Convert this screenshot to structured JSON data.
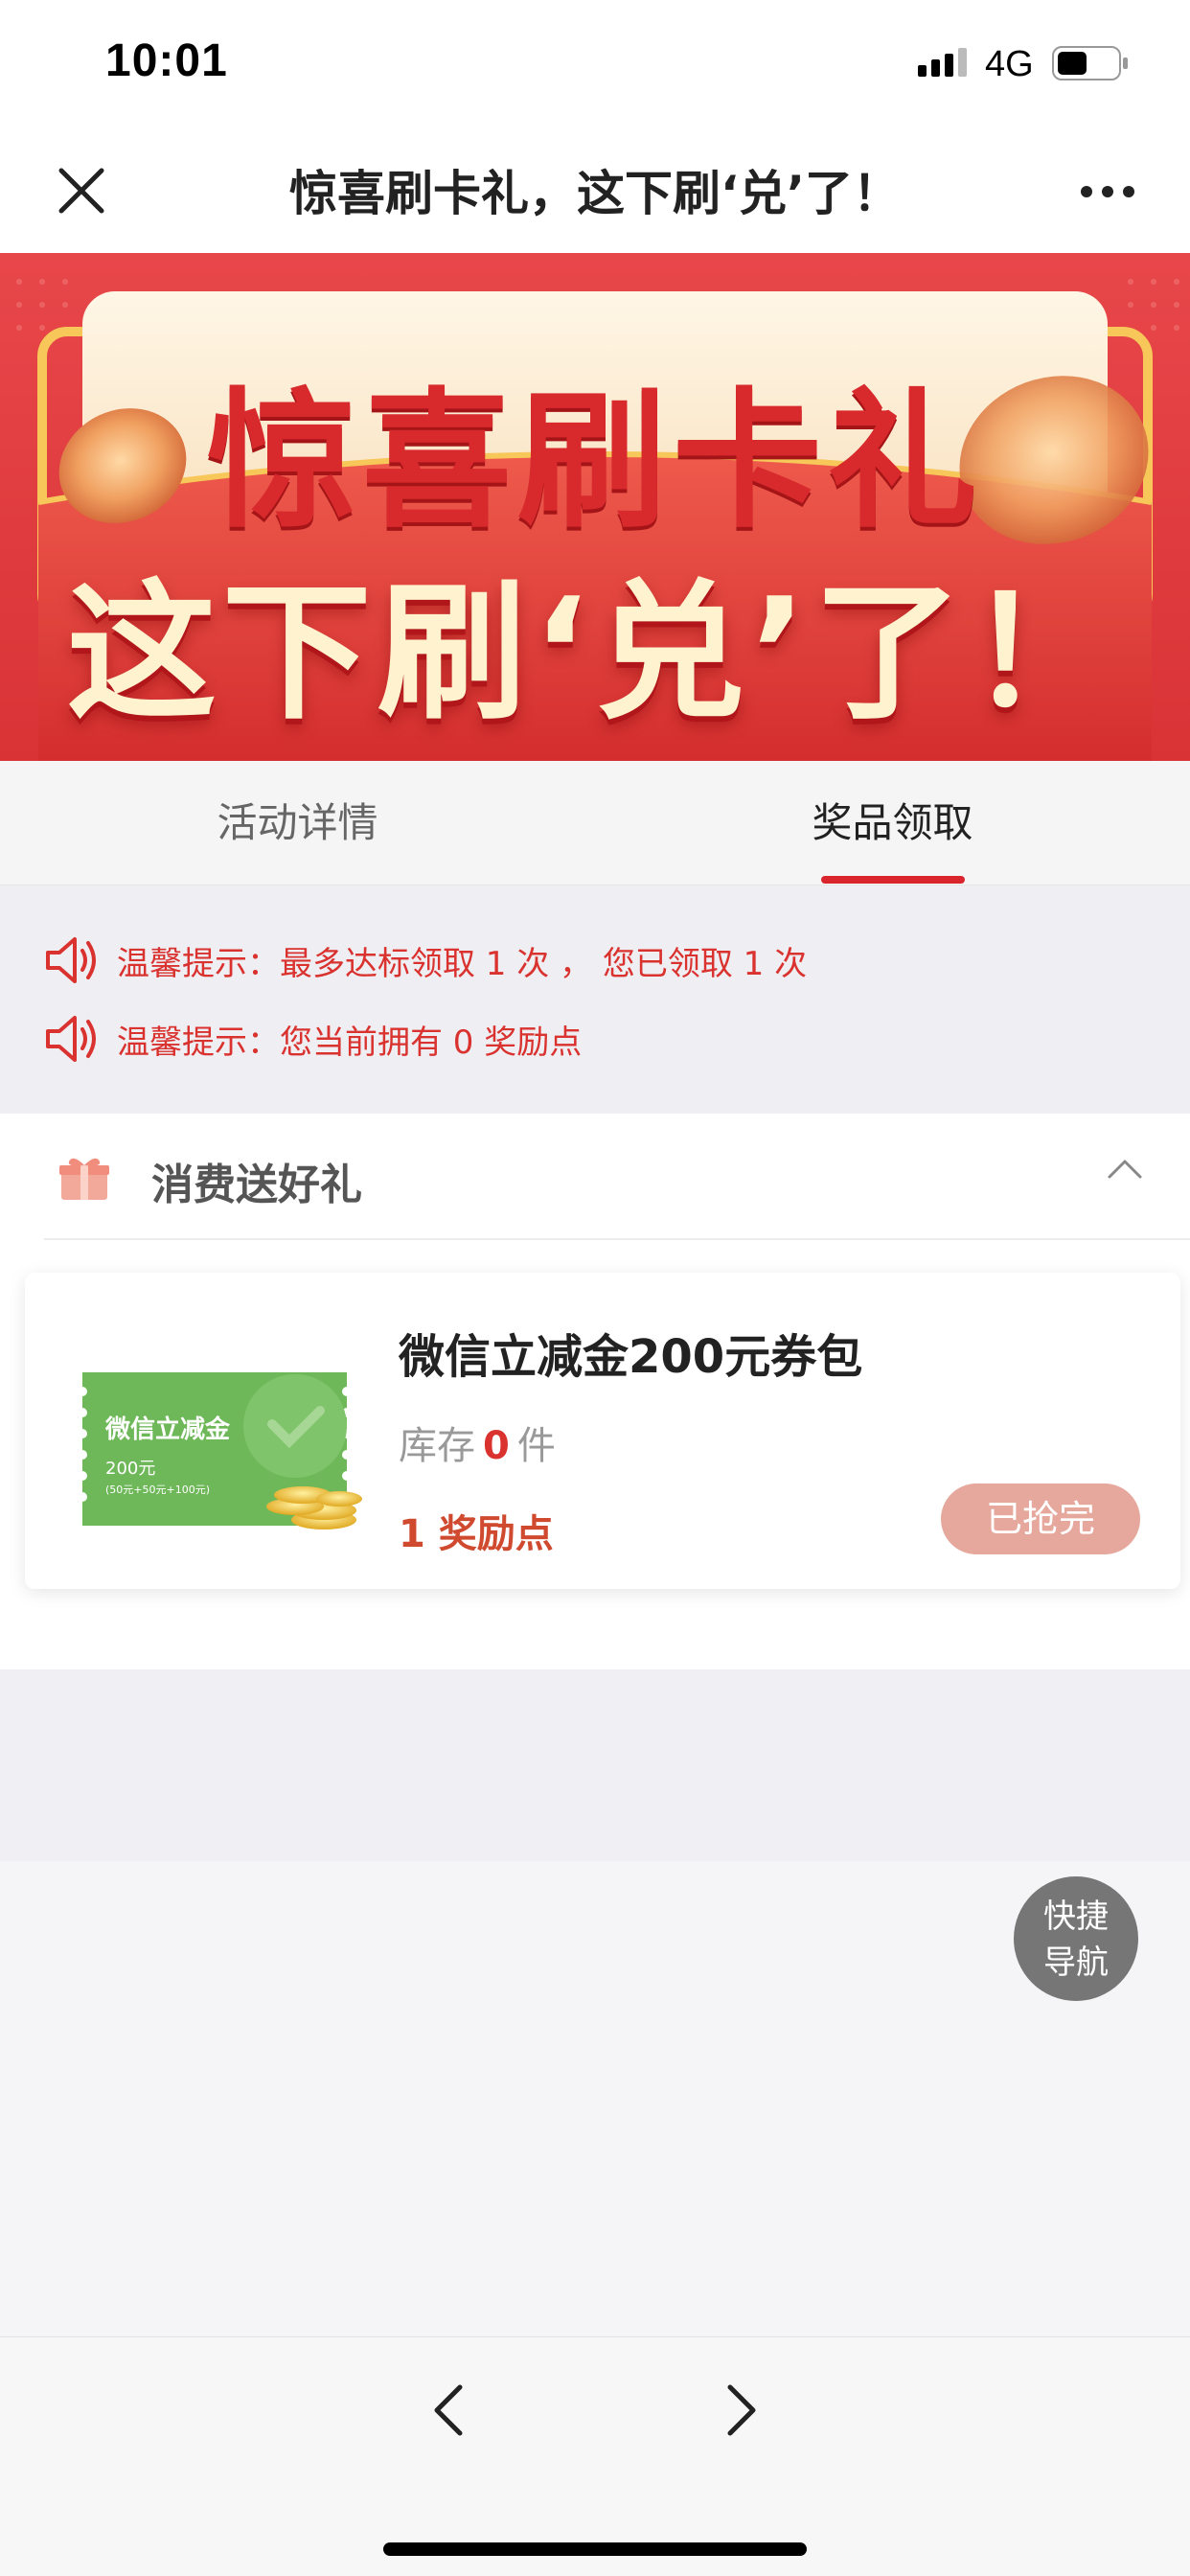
{
  "status_bar": {
    "time": "10:01",
    "network": "4G",
    "icons": [
      "signal-icon",
      "battery-icon"
    ]
  },
  "nav": {
    "title": "惊喜刷卡礼，这下刷‘兑’了！",
    "icons": [
      "close-icon",
      "more-icon"
    ]
  },
  "banner": {
    "line1": "惊喜刷卡礼",
    "line2": "这下刷‘兑’了！",
    "colors": {
      "background": "#e03c3f",
      "headline": "#d8292c",
      "subline": "#fff2cf"
    }
  },
  "tabs": [
    {
      "label": "活动详情",
      "active": false
    },
    {
      "label": "奖品领取",
      "active": true
    }
  ],
  "notices": [
    {
      "icon": "speaker-icon",
      "text": "温馨提示：最多达标领取 1 次 ， 您已领取 1 次"
    },
    {
      "icon": "speaker-icon",
      "text": "温馨提示：您当前拥有 0 奖励点"
    }
  ],
  "section": {
    "title": "消费送好礼",
    "icon": "gift-icon",
    "collapse_icon": "chevron-up-icon"
  },
  "prize": {
    "title": "微信立减金200元券包",
    "stock_label": "库存",
    "stock_count": "0",
    "stock_unit": "件",
    "points": "1 奖励点",
    "button": "已抢完",
    "coupon": {
      "name": "微信立减金",
      "amount": "200元",
      "detail": "(50元+50元+100元)"
    }
  },
  "quick_nav": {
    "line1": "快捷",
    "line2": "导航"
  },
  "bottom": {
    "icons": [
      "back-arrow-icon",
      "forward-arrow-icon"
    ]
  },
  "colors": {
    "accent": "#d9252b",
    "notice": "#d9322f",
    "points": "#d04a2f",
    "button_disabled": "#e6a89c"
  }
}
